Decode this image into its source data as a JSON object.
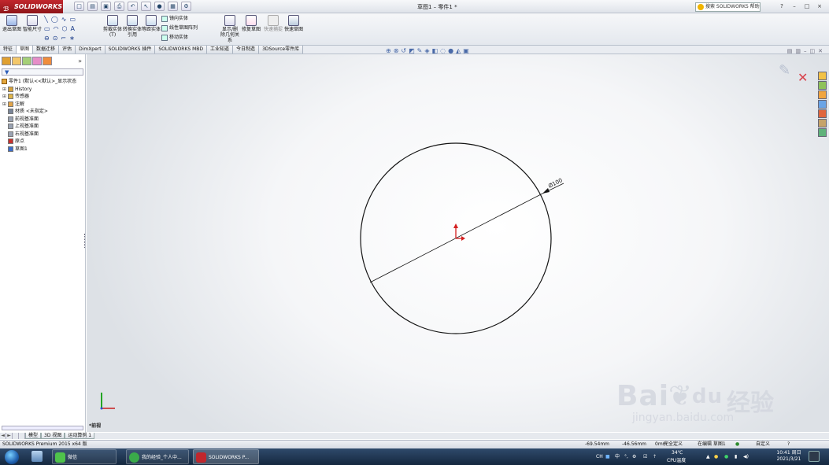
{
  "title_bar": {
    "app_logo": "SOLIDWORKS",
    "doc_title": "草图1 – 零件1 *",
    "help_search_placeholder": "搜索 SOLIDWORKS 帮助",
    "window_buttons": [
      "?",
      "–",
      "□",
      "×"
    ]
  },
  "command_manager": {
    "exit_sketch": "退出草图",
    "smart_dimension": "智能尺寸",
    "trim_entities": "剪裁实体(T)",
    "convert_entities": "转换实体引用",
    "offset_entities": "等距实体",
    "mirror_entities": "镜向实体",
    "linear_pattern": "线性草图阵列",
    "move_entities": "移动实体",
    "display_relations": "显示/删除几何关系",
    "repair_sketch": "修复草图",
    "quick_snaps": "快速捕捉",
    "rapid_sketch": "快速草图"
  },
  "command_tabs": [
    {
      "label": "特征",
      "active": false
    },
    {
      "label": "草图",
      "active": true
    },
    {
      "label": "数据迁移",
      "active": false
    },
    {
      "label": "评估",
      "active": false
    },
    {
      "label": "DimXpert",
      "active": false
    },
    {
      "label": "SOLIDWORKS 插件",
      "active": false
    },
    {
      "label": "SOLIDWORKS MBD",
      "active": false
    },
    {
      "label": "工业知道",
      "active": false
    },
    {
      "label": "今日制造",
      "active": false
    },
    {
      "label": "3DSource零件库",
      "active": false
    }
  ],
  "feature_tree": {
    "root": "零件1 (默认<<默认>_显示状态",
    "items": [
      {
        "label": "History",
        "icon": "history-icon",
        "color": "#d7a23a"
      },
      {
        "label": "传感器",
        "icon": "sensor-icon",
        "color": "#e0b64a"
      },
      {
        "label": "注解",
        "icon": "annotation-icon",
        "color": "#e2a54a"
      },
      {
        "label": "材质 <未指定>",
        "icon": "material-icon",
        "color": "#7a8598"
      },
      {
        "label": "前视基准面",
        "icon": "plane-icon",
        "color": "#9aa3b3"
      },
      {
        "label": "上视基准面",
        "icon": "plane-icon",
        "color": "#9aa3b3"
      },
      {
        "label": "右视基准面",
        "icon": "plane-icon",
        "color": "#9aa3b3"
      },
      {
        "label": "原点",
        "icon": "origin-icon",
        "color": "#c9302c"
      },
      {
        "label": "草图1",
        "icon": "sketch-icon",
        "color": "#3d6ec9"
      }
    ]
  },
  "sketch": {
    "dimension_label": "Ø100",
    "colors": {
      "geometry": "#141414",
      "origin": "#d31f1f",
      "triad_y": "#23a523",
      "triad_x": "#c81e1e",
      "triad_z": "#2a4fd0"
    }
  },
  "graphics": {
    "view_label": "*前视"
  },
  "model_tabs": [
    "模型",
    "3D 视图",
    "运动算例 1"
  ],
  "model_tab_nav": [
    "◄",
    "►"
  ],
  "status_bar": {
    "product": "SOLIDWORKS Premium 2015 x64 版",
    "x_coord": "-69.54mm",
    "y_coord": "-46.56mm",
    "z_coord": "0mm",
    "definition": "完全定义",
    "editing": "在编辑 草图1",
    "units": "自定义",
    "help": "?"
  },
  "taskbar": {
    "apps": [
      "微信",
      "我的经验_个人中...",
      "SOLIDWORKS P..."
    ],
    "tray_ime": "CH",
    "tray_lang": "中",
    "temperature": "34℃",
    "temperature_label": "CPU温度",
    "time": "10:41 周日",
    "date": "2021/3/21"
  },
  "watermark": {
    "brand": "Bai",
    "brand_du": "du",
    "brand_jy": "经验",
    "url": "jingyan.baidu.com"
  }
}
